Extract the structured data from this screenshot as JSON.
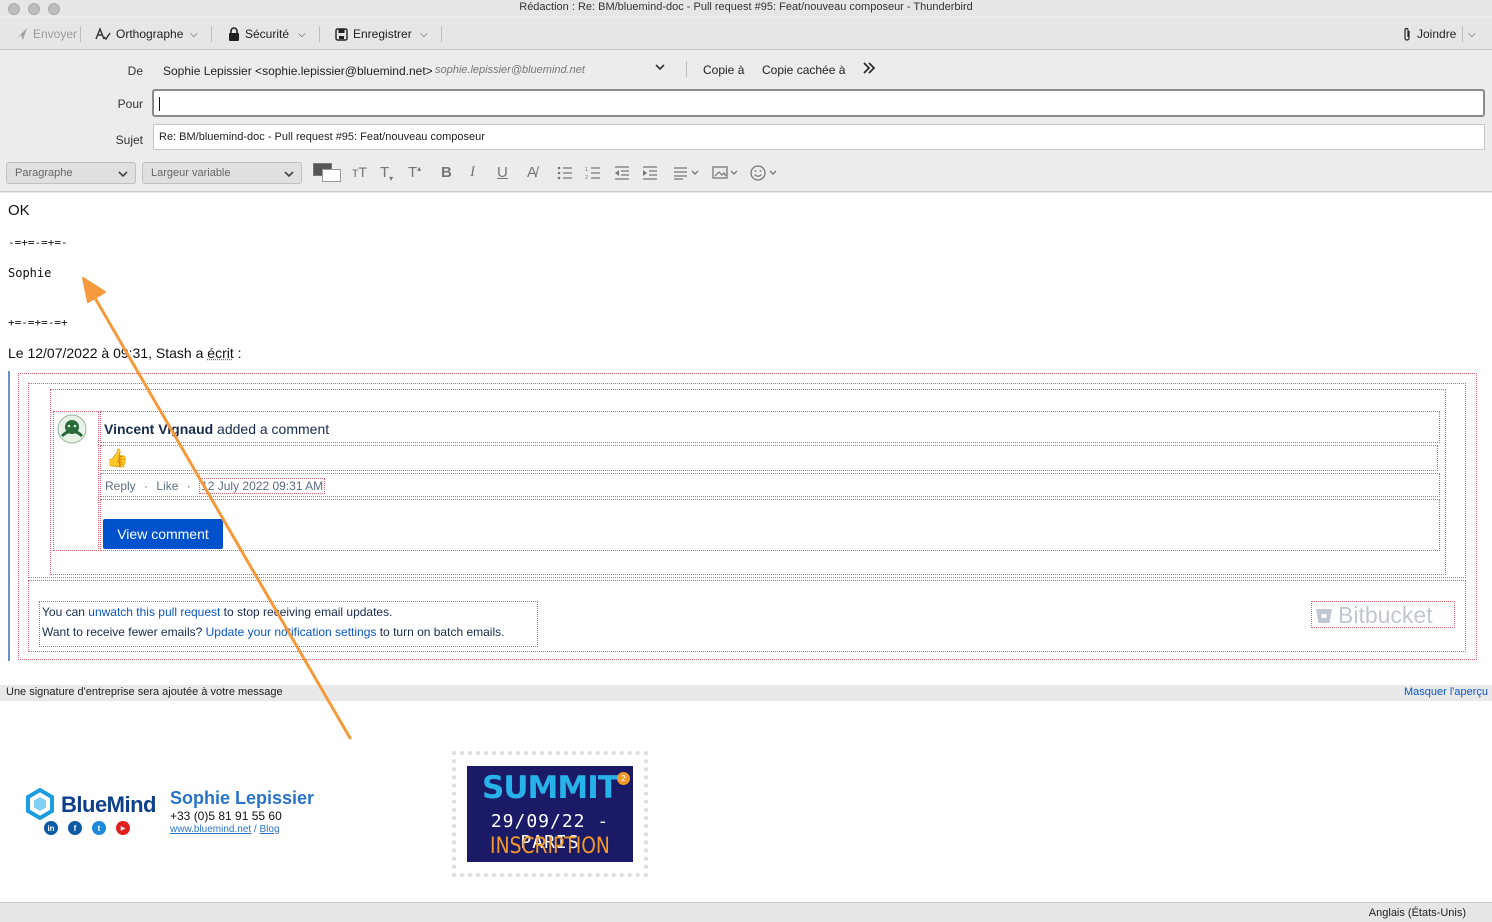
{
  "window": {
    "title": "Rédaction : Re: BM/bluemind-doc - Pull request #95: Feat/nouveau composeur - Thunderbird"
  },
  "toolbar": {
    "send": "Envoyer",
    "spelling": "Orthographe",
    "security": "Sécurité",
    "save": "Enregistrer",
    "attach": "Joindre"
  },
  "header": {
    "from_label": "De",
    "from_value": "Sophie Lepissier <sophie.lepissier@bluemind.net>",
    "from_identity": "sophie.lepissier@bluemind.net",
    "cc_label": "Copie à",
    "bcc_label": "Copie cachée à",
    "to_label": "Pour",
    "to_value": "",
    "subject_label": "Sujet",
    "subject_value": "Re: BM/bluemind-doc - Pull request #95: Feat/nouveau composeur"
  },
  "format": {
    "paragraph": "Paragraphe",
    "font": "Largeur variable"
  },
  "message": {
    "reply": "OK",
    "sig_top": "-=+=-=+=-",
    "sig_name": "Sophie",
    "sig_bottom": "+=-=+=-=+",
    "quote_header_pre": "Le 12/07/2022 à 09:31, Stash a ",
    "quote_header_word": "écrit",
    "quote_header_post": " :"
  },
  "quoted": {
    "author": "Vincent Vignaud",
    "action": " added a comment",
    "emoji": "👍",
    "reply_link": "Reply",
    "like_link": "Like",
    "date": "12 July 2022 09:31 AM",
    "dot": "·",
    "view_button": "View comment",
    "footer1_pre": "You can ",
    "footer1_link": "unwatch this pull request",
    "footer1_post": " to stop receiving email updates.",
    "footer2_pre": "Want to receive fewer emails? ",
    "footer2_link": "Update your notification settings",
    "footer2_post": " to turn on batch emails.",
    "brand": "Bitbucket"
  },
  "signature_notice": {
    "text": "Une signature d'entreprise sera ajoutée à votre message",
    "hide_link": "Masquer l'aperçu"
  },
  "signature": {
    "company": "BlueMind",
    "name": "Sophie Lepissier",
    "phone": "+33 (0)5 81 91 55 60",
    "website": "www.bluemind.net",
    "slash": " / ",
    "blog": "Blog",
    "social": [
      "in",
      "f",
      "t",
      "▶"
    ],
    "banner_title": "SUMMIT",
    "banner_badge": "2",
    "banner_date": "29/09/22 - PARIS",
    "banner_cta": "INSCRIPTION"
  },
  "statusbar": {
    "language": "Anglais (États-Unis)"
  },
  "colors": {
    "accent": "#0b57c5",
    "annotation": "#f49a3c",
    "bluemind": "#0e3f8a",
    "banner_bg": "#1b1a66",
    "banner_cta": "#f29a27"
  }
}
